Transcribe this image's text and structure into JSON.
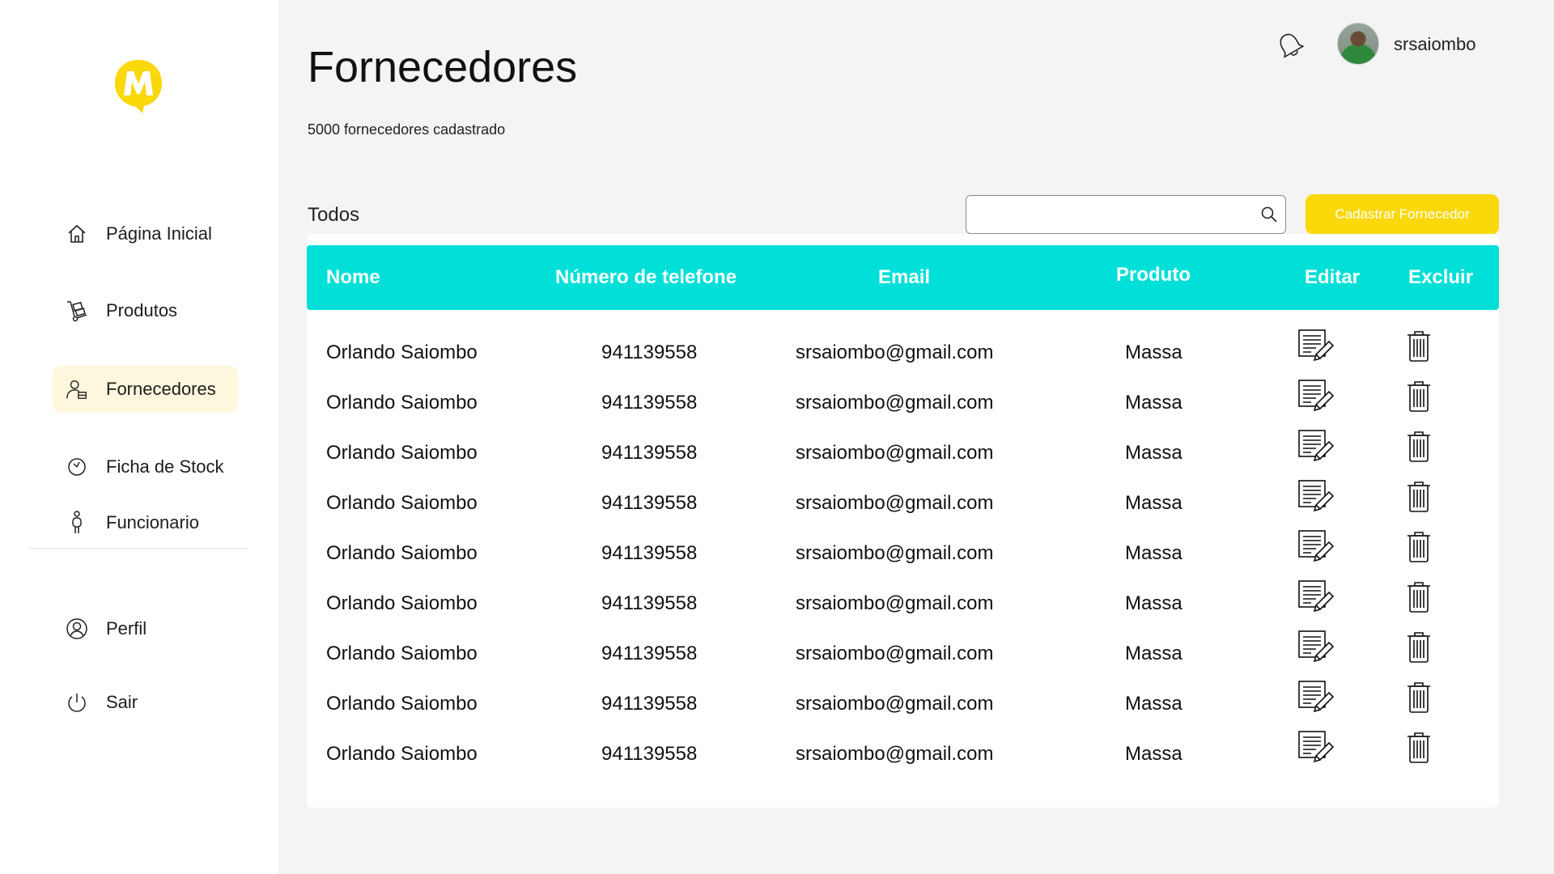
{
  "brand": {
    "logo_letter": "M",
    "accent_color": "#fad80a"
  },
  "sidebar": {
    "items": [
      {
        "label": "Página Inicial",
        "icon": "home-icon"
      },
      {
        "label": "Produtos",
        "icon": "hand-truck-icon"
      },
      {
        "label": "Fornecedores",
        "icon": "supplier-icon",
        "active": true
      },
      {
        "label": "Ficha de Stock",
        "icon": "clock-icon"
      },
      {
        "label": "Funcionario",
        "icon": "person-icon"
      },
      {
        "label": "Perfil",
        "icon": "user-circle-icon"
      },
      {
        "label": "Sair",
        "icon": "power-icon"
      }
    ]
  },
  "header": {
    "title": "Fornecedores",
    "subtitle": "5000 fornecedores cadastrado",
    "notification_icon": "bell-icon",
    "username": "srsaiombo"
  },
  "toolbar": {
    "filter_label": "Todos",
    "search_placeholder": "",
    "search_value": "",
    "add_button_label": "Cadastrar  Fornecedor"
  },
  "table": {
    "header_color": "#00e0d8",
    "columns": [
      "Nome",
      "Número  de  telefone",
      "Email",
      "Produto",
      "Editar",
      "Excluir"
    ],
    "rows": [
      {
        "name": "Orlando Saiombo",
        "phone": "941139558",
        "email": "srsaiombo@gmail.com",
        "product": "Massa"
      },
      {
        "name": "Orlando Saiombo",
        "phone": "941139558",
        "email": "srsaiombo@gmail.com",
        "product": "Massa"
      },
      {
        "name": "Orlando Saiombo",
        "phone": "941139558",
        "email": "srsaiombo@gmail.com",
        "product": "Massa"
      },
      {
        "name": "Orlando Saiombo",
        "phone": "941139558",
        "email": "srsaiombo@gmail.com",
        "product": "Massa"
      },
      {
        "name": "Orlando Saiombo",
        "phone": "941139558",
        "email": "srsaiombo@gmail.com",
        "product": "Massa"
      },
      {
        "name": "Orlando Saiombo",
        "phone": "941139558",
        "email": "srsaiombo@gmail.com",
        "product": "Massa"
      },
      {
        "name": "Orlando Saiombo",
        "phone": "941139558",
        "email": "srsaiombo@gmail.com",
        "product": "Massa"
      },
      {
        "name": "Orlando Saiombo",
        "phone": "941139558",
        "email": "srsaiombo@gmail.com",
        "product": "Massa"
      },
      {
        "name": "Orlando Saiombo",
        "phone": "941139558",
        "email": "srsaiombo@gmail.com",
        "product": "Massa"
      }
    ]
  }
}
